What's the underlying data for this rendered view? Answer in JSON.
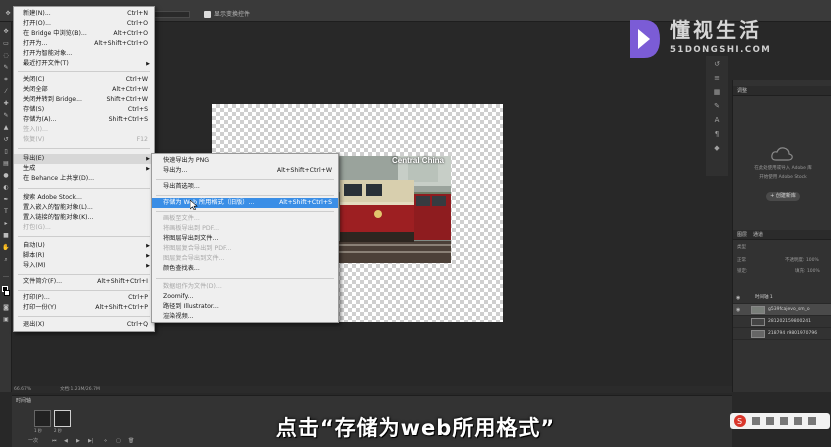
{
  "topbar": {
    "checkbox_label": "显示变换控件"
  },
  "menu": {
    "items": [
      {
        "label": "新建(N)...",
        "shortcut": "Ctrl+N"
      },
      {
        "label": "打开(O)...",
        "shortcut": "Ctrl+O"
      },
      {
        "label": "在 Bridge 中浏览(B)...",
        "shortcut": "Alt+Ctrl+O"
      },
      {
        "label": "打开为...",
        "shortcut": "Alt+Shift+Ctrl+O"
      },
      {
        "label": "打开为智能对象...",
        "shortcut": ""
      },
      {
        "label": "最近打开文件(T)",
        "shortcut": ""
      },
      {
        "label": "关闭(C)",
        "shortcut": "Ctrl+W"
      },
      {
        "label": "关闭全部",
        "shortcut": "Alt+Ctrl+W"
      },
      {
        "label": "关闭并转到 Bridge...",
        "shortcut": "Shift+Ctrl+W"
      },
      {
        "label": "存储(S)",
        "shortcut": "Ctrl+S"
      },
      {
        "label": "存储为(A)...",
        "shortcut": "Shift+Ctrl+S"
      },
      {
        "label": "签入(I)...",
        "shortcut": ""
      },
      {
        "label": "恢复(V)",
        "shortcut": "F12"
      },
      {
        "label": "导出(E)",
        "shortcut": ""
      },
      {
        "label": "生成",
        "shortcut": ""
      },
      {
        "label": "在 Behance 上共享(D)...",
        "shortcut": ""
      },
      {
        "label": "搜索 Adobe Stock...",
        "shortcut": ""
      },
      {
        "label": "置入嵌入的智能对象(L)...",
        "shortcut": ""
      },
      {
        "label": "置入链接的智能对象(K)...",
        "shortcut": ""
      },
      {
        "label": "打包(G)...",
        "shortcut": ""
      },
      {
        "label": "自动(U)",
        "shortcut": ""
      },
      {
        "label": "脚本(R)",
        "shortcut": ""
      },
      {
        "label": "导入(M)",
        "shortcut": ""
      },
      {
        "label": "文件简介(F)...",
        "shortcut": "Alt+Shift+Ctrl+I"
      },
      {
        "label": "打印(P)...",
        "shortcut": "Ctrl+P"
      },
      {
        "label": "打印一份(Y)",
        "shortcut": "Alt+Shift+Ctrl+P"
      },
      {
        "label": "退出(X)",
        "shortcut": "Ctrl+Q"
      }
    ]
  },
  "submenu": {
    "items": [
      {
        "label": "快速导出为 PNG",
        "shortcut": ""
      },
      {
        "label": "导出为...",
        "shortcut": "Alt+Shift+Ctrl+W"
      },
      {
        "label": "导出首选项...",
        "shortcut": ""
      },
      {
        "label": "存储为 Web 所用格式（旧版）...",
        "shortcut": "Alt+Shift+Ctrl+S"
      },
      {
        "label": "画板至文件...",
        "shortcut": ""
      },
      {
        "label": "将画板导出到 PDF...",
        "shortcut": ""
      },
      {
        "label": "将图层导出到文件...",
        "shortcut": ""
      },
      {
        "label": "将图层复合导出到 PDF...",
        "shortcut": ""
      },
      {
        "label": "图层复合导出到文件...",
        "shortcut": ""
      },
      {
        "label": "颜色查找表...",
        "shortcut": ""
      },
      {
        "label": "数据组作为文件(D)...",
        "shortcut": ""
      },
      {
        "label": "Zoomify...",
        "shortcut": ""
      },
      {
        "label": "路径到 Illustrator...",
        "shortcut": ""
      },
      {
        "label": "渲染视频...",
        "shortcut": ""
      }
    ]
  },
  "canvas": {
    "photo_caption": "Central China"
  },
  "panels": {
    "library_tab": "调整",
    "library_msg1": "在此处使用或导入 Adobe 库",
    "library_msg2": "开始使用 Adobe Stock",
    "library_button": "+ 创建新库",
    "layers_tab": "图层",
    "channels_tab": "通道",
    "kind_label": "类型",
    "blend_mode": "正常",
    "opacity_label": "不透明度: 100%",
    "lock_label": "锁定:",
    "fill_label": "填充: 100%",
    "layers": [
      {
        "name": "时间轴 1"
      },
      {
        "name": "g539fcajevo_sm_o"
      },
      {
        "name": "281202159800241"
      },
      {
        "name": "218794 r9801970796"
      }
    ]
  },
  "status": {
    "zoom": "66.67%",
    "doc": "文档:1.23M/26.7M"
  },
  "timeline": {
    "title": "时间轴",
    "frame1": "1 秒",
    "frame2": "2 秒",
    "loop": "一次"
  },
  "logo": {
    "cn": "懂视生活",
    "en": "51DONGSHI.COM"
  },
  "subtitle": "点击“存储为web所用格式”"
}
